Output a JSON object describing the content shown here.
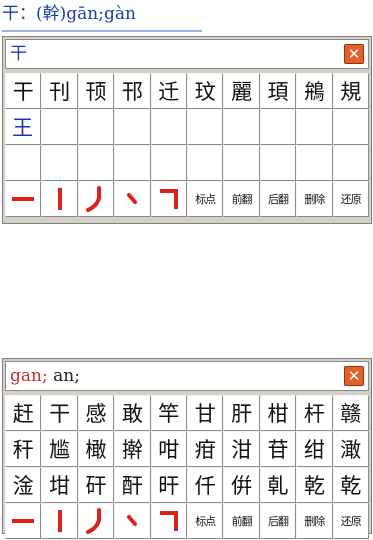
{
  "entry": {
    "text": "干：(幹)gān;gàn"
  },
  "top_panel": {
    "input_value": "干",
    "close_glyph": "✕",
    "candidates": [
      "干",
      "刊",
      "顸",
      "邗",
      "迁",
      "玟",
      "麗",
      "頊",
      "鴘",
      "規"
    ],
    "row2": [
      "王",
      "",
      "",
      "",
      "",
      "",
      "",
      "",
      "",
      ""
    ],
    "row3": [
      "",
      "",
      "",
      "",
      "",
      "",
      "",
      "",
      "",
      ""
    ],
    "strokes": [
      "一",
      "丨",
      "丿",
      "丶",
      "乛"
    ],
    "functions": [
      "标点",
      "前翻",
      "后翻",
      "删除",
      "还原"
    ]
  },
  "bottom_panel": {
    "input_pinyin": "gan;",
    "input_rest": " an;",
    "close_glyph": "✕",
    "rows": [
      [
        "赶",
        "干",
        "感",
        "敢",
        "竿",
        "甘",
        "肝",
        "柑",
        "杆",
        "赣"
      ],
      [
        "秆",
        "尴",
        "橄",
        "擀",
        "咁",
        "疳",
        "泔",
        "苷",
        "绀",
        "澉"
      ],
      [
        "淦",
        "坩",
        "矸",
        "酐",
        "旰",
        "仟",
        "倂",
        "乹",
        "乾",
        "乾"
      ]
    ],
    "strokes": [
      "一",
      "丨",
      "丿",
      "丶",
      "乛"
    ],
    "functions": [
      "标点",
      "前翻",
      "后翻",
      "删除",
      "还原"
    ]
  }
}
